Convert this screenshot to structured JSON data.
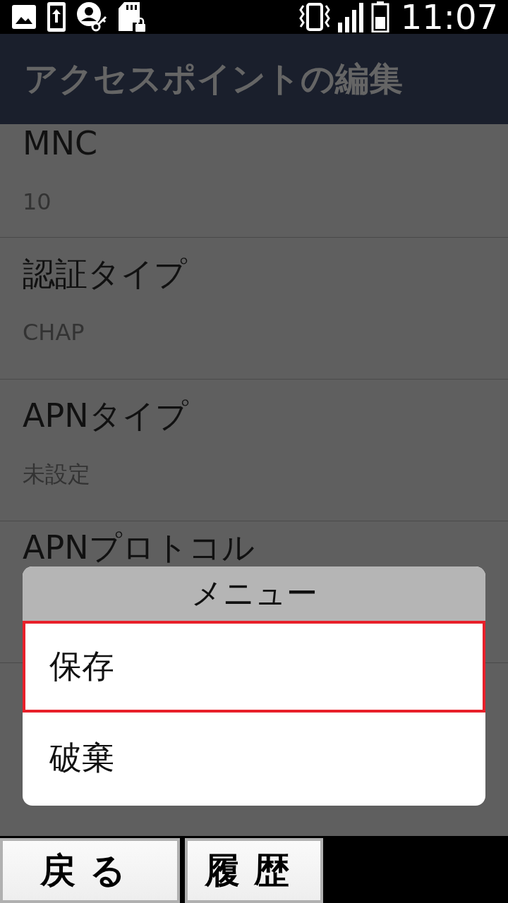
{
  "status_bar": {
    "time": "11:07"
  },
  "app_bar": {
    "title": "アクセスポイントの編集"
  },
  "settings": [
    {
      "title": "MNC",
      "value": "10"
    },
    {
      "title": "認証タイプ",
      "value": "CHAP"
    },
    {
      "title": "APNタイプ",
      "value": "未設定"
    },
    {
      "title": "APNプロトコル"
    }
  ],
  "menu": {
    "title": "メニュー",
    "items": [
      {
        "label": "保存",
        "selected": true
      },
      {
        "label": "破棄",
        "selected": false
      }
    ]
  },
  "bottom_buttons": [
    "戻る",
    "履歴"
  ]
}
